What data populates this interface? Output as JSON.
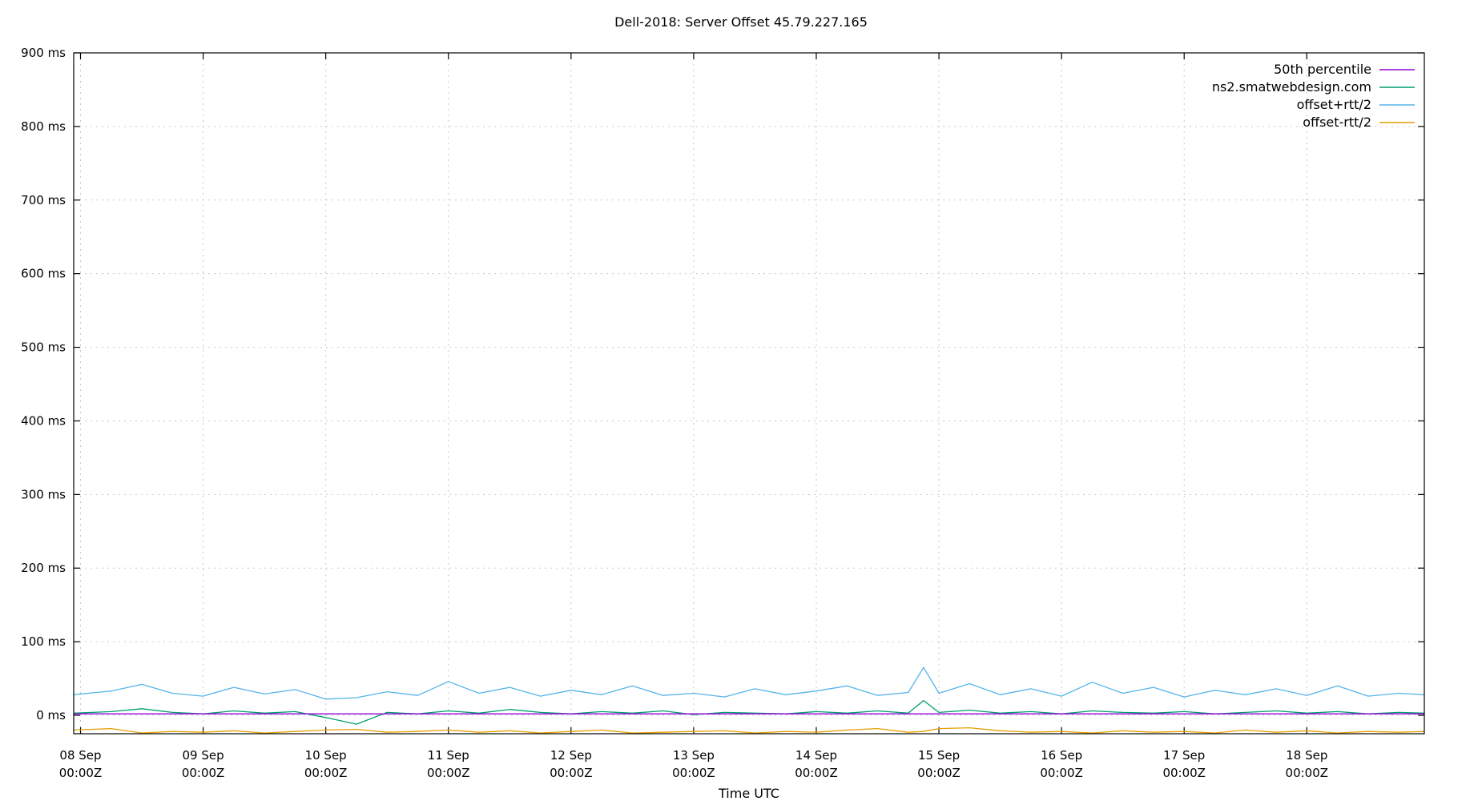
{
  "chart_data": {
    "type": "line",
    "title": "Dell-2018: Server Offset 45.79.227.165",
    "xlabel": "Time UTC",
    "ylabel": "",
    "x_range": [
      "2024-09-07T22:40:00Z",
      "2024-09-18T23:00:00Z"
    ],
    "ylim": [
      -25,
      900
    ],
    "y_ticks": [
      {
        "value": 0,
        "label": "0 ms"
      },
      {
        "value": 100,
        "label": "100 ms"
      },
      {
        "value": 200,
        "label": "200 ms"
      },
      {
        "value": 300,
        "label": "300 ms"
      },
      {
        "value": 400,
        "label": "400 ms"
      },
      {
        "value": 500,
        "label": "500 ms"
      },
      {
        "value": 600,
        "label": "600 ms"
      },
      {
        "value": 700,
        "label": "700 ms"
      },
      {
        "value": 800,
        "label": "800 ms"
      },
      {
        "value": 900,
        "label": "900 ms"
      }
    ],
    "x_ticks": [
      {
        "value": "2024-09-08T00:00:00Z",
        "line1": "08 Sep",
        "line2": "00:00Z"
      },
      {
        "value": "2024-09-09T00:00:00Z",
        "line1": "09 Sep",
        "line2": "00:00Z"
      },
      {
        "value": "2024-09-10T00:00:00Z",
        "line1": "10 Sep",
        "line2": "00:00Z"
      },
      {
        "value": "2024-09-11T00:00:00Z",
        "line1": "11 Sep",
        "line2": "00:00Z"
      },
      {
        "value": "2024-09-12T00:00:00Z",
        "line1": "12 Sep",
        "line2": "00:00Z"
      },
      {
        "value": "2024-09-13T00:00:00Z",
        "line1": "13 Sep",
        "line2": "00:00Z"
      },
      {
        "value": "2024-09-14T00:00:00Z",
        "line1": "14 Sep",
        "line2": "00:00Z"
      },
      {
        "value": "2024-09-15T00:00:00Z",
        "line1": "15 Sep",
        "line2": "00:00Z"
      },
      {
        "value": "2024-09-16T00:00:00Z",
        "line1": "16 Sep",
        "line2": "00:00Z"
      },
      {
        "value": "2024-09-17T00:00:00Z",
        "line1": "17 Sep",
        "line2": "00:00Z"
      },
      {
        "value": "2024-09-18T00:00:00Z",
        "line1": "18 Sep",
        "line2": "00:00Z"
      }
    ],
    "grid": true,
    "legend_position": "top-right",
    "series": [
      {
        "name": "50th percentile",
        "color": "#9400d3",
        "x": [
          "2024-09-07T22:40:00Z",
          "2024-09-18T23:00:00Z"
        ],
        "values": [
          2,
          2
        ]
      },
      {
        "name": "ns2.smatwebdesign.com",
        "color": "#009e73",
        "x": [
          "2024-09-07T22:40:00Z",
          "2024-09-08T06:00:00Z",
          "2024-09-08T12:00:00Z",
          "2024-09-08T18:00:00Z",
          "2024-09-09T00:00:00Z",
          "2024-09-09T06:00:00Z",
          "2024-09-09T12:00:00Z",
          "2024-09-09T18:00:00Z",
          "2024-09-10T00:00:00Z",
          "2024-09-10T06:00:00Z",
          "2024-09-10T12:00:00Z",
          "2024-09-10T18:00:00Z",
          "2024-09-11T00:00:00Z",
          "2024-09-11T06:00:00Z",
          "2024-09-11T12:00:00Z",
          "2024-09-11T18:00:00Z",
          "2024-09-12T00:00:00Z",
          "2024-09-12T06:00:00Z",
          "2024-09-12T12:00:00Z",
          "2024-09-12T18:00:00Z",
          "2024-09-13T00:00:00Z",
          "2024-09-13T06:00:00Z",
          "2024-09-13T12:00:00Z",
          "2024-09-13T18:00:00Z",
          "2024-09-14T00:00:00Z",
          "2024-09-14T06:00:00Z",
          "2024-09-14T12:00:00Z",
          "2024-09-14T18:00:00Z",
          "2024-09-14T21:00:00Z",
          "2024-09-15T00:00:00Z",
          "2024-09-15T06:00:00Z",
          "2024-09-15T12:00:00Z",
          "2024-09-15T18:00:00Z",
          "2024-09-16T00:00:00Z",
          "2024-09-16T06:00:00Z",
          "2024-09-16T12:00:00Z",
          "2024-09-16T18:00:00Z",
          "2024-09-17T00:00:00Z",
          "2024-09-17T06:00:00Z",
          "2024-09-17T12:00:00Z",
          "2024-09-17T18:00:00Z",
          "2024-09-18T00:00:00Z",
          "2024-09-18T06:00:00Z",
          "2024-09-18T12:00:00Z",
          "2024-09-18T18:00:00Z",
          "2024-09-18T23:00:00Z"
        ],
        "values": [
          3,
          5,
          9,
          4,
          2,
          6,
          3,
          5,
          -3,
          -12,
          4,
          2,
          6,
          3,
          8,
          4,
          2,
          5,
          3,
          6,
          1,
          4,
          3,
          2,
          5,
          3,
          6,
          3,
          20,
          4,
          7,
          3,
          5,
          2,
          6,
          4,
          3,
          5,
          2,
          4,
          6,
          3,
          5,
          2,
          4,
          3
        ]
      },
      {
        "name": "offset+rtt/2",
        "color": "#56b4e9",
        "x": [
          "2024-09-07T22:40:00Z",
          "2024-09-08T06:00:00Z",
          "2024-09-08T12:00:00Z",
          "2024-09-08T18:00:00Z",
          "2024-09-09T00:00:00Z",
          "2024-09-09T06:00:00Z",
          "2024-09-09T12:00:00Z",
          "2024-09-09T18:00:00Z",
          "2024-09-10T00:00:00Z",
          "2024-09-10T06:00:00Z",
          "2024-09-10T12:00:00Z",
          "2024-09-10T18:00:00Z",
          "2024-09-11T00:00:00Z",
          "2024-09-11T06:00:00Z",
          "2024-09-11T12:00:00Z",
          "2024-09-11T18:00:00Z",
          "2024-09-12T00:00:00Z",
          "2024-09-12T06:00:00Z",
          "2024-09-12T12:00:00Z",
          "2024-09-12T18:00:00Z",
          "2024-09-13T00:00:00Z",
          "2024-09-13T06:00:00Z",
          "2024-09-13T12:00:00Z",
          "2024-09-13T18:00:00Z",
          "2024-09-14T00:00:00Z",
          "2024-09-14T06:00:00Z",
          "2024-09-14T12:00:00Z",
          "2024-09-14T18:00:00Z",
          "2024-09-14T21:00:00Z",
          "2024-09-15T00:00:00Z",
          "2024-09-15T06:00:00Z",
          "2024-09-15T12:00:00Z",
          "2024-09-15T18:00:00Z",
          "2024-09-16T00:00:00Z",
          "2024-09-16T06:00:00Z",
          "2024-09-16T12:00:00Z",
          "2024-09-16T18:00:00Z",
          "2024-09-17T00:00:00Z",
          "2024-09-17T06:00:00Z",
          "2024-09-17T12:00:00Z",
          "2024-09-17T18:00:00Z",
          "2024-09-18T00:00:00Z",
          "2024-09-18T06:00:00Z",
          "2024-09-18T12:00:00Z",
          "2024-09-18T18:00:00Z",
          "2024-09-18T23:00:00Z"
        ],
        "values": [
          28,
          33,
          42,
          30,
          26,
          38,
          29,
          35,
          22,
          24,
          32,
          27,
          46,
          30,
          38,
          26,
          34,
          28,
          40,
          27,
          30,
          25,
          36,
          28,
          33,
          40,
          27,
          31,
          65,
          30,
          43,
          28,
          36,
          26,
          45,
          30,
          38,
          25,
          34,
          28,
          36,
          27,
          40,
          26,
          30,
          28
        ]
      },
      {
        "name": "offset-rtt/2",
        "color": "#e69f00",
        "x": [
          "2024-09-07T22:40:00Z",
          "2024-09-08T06:00:00Z",
          "2024-09-08T12:00:00Z",
          "2024-09-08T18:00:00Z",
          "2024-09-09T00:00:00Z",
          "2024-09-09T06:00:00Z",
          "2024-09-09T12:00:00Z",
          "2024-09-09T18:00:00Z",
          "2024-09-10T00:00:00Z",
          "2024-09-10T06:00:00Z",
          "2024-09-10T12:00:00Z",
          "2024-09-10T18:00:00Z",
          "2024-09-11T00:00:00Z",
          "2024-09-11T06:00:00Z",
          "2024-09-11T12:00:00Z",
          "2024-09-11T18:00:00Z",
          "2024-09-12T00:00:00Z",
          "2024-09-12T06:00:00Z",
          "2024-09-12T12:00:00Z",
          "2024-09-12T18:00:00Z",
          "2024-09-13T00:00:00Z",
          "2024-09-13T06:00:00Z",
          "2024-09-13T12:00:00Z",
          "2024-09-13T18:00:00Z",
          "2024-09-14T00:00:00Z",
          "2024-09-14T06:00:00Z",
          "2024-09-14T12:00:00Z",
          "2024-09-14T18:00:00Z",
          "2024-09-14T21:00:00Z",
          "2024-09-15T00:00:00Z",
          "2024-09-15T06:00:00Z",
          "2024-09-15T12:00:00Z",
          "2024-09-15T18:00:00Z",
          "2024-09-16T00:00:00Z",
          "2024-09-16T06:00:00Z",
          "2024-09-16T12:00:00Z",
          "2024-09-16T18:00:00Z",
          "2024-09-17T00:00:00Z",
          "2024-09-17T06:00:00Z",
          "2024-09-17T12:00:00Z",
          "2024-09-17T18:00:00Z",
          "2024-09-18T00:00:00Z",
          "2024-09-18T06:00:00Z",
          "2024-09-18T12:00:00Z",
          "2024-09-18T18:00:00Z",
          "2024-09-18T23:00:00Z"
        ],
        "values": [
          -20,
          -18,
          -24,
          -22,
          -23,
          -21,
          -24,
          -22,
          -20,
          -19,
          -23,
          -22,
          -20,
          -23,
          -21,
          -24,
          -22,
          -20,
          -24,
          -23,
          -22,
          -21,
          -24,
          -22,
          -23,
          -20,
          -18,
          -23,
          -22,
          -18,
          -17,
          -21,
          -23,
          -22,
          -24,
          -21,
          -23,
          -22,
          -24,
          -20,
          -23,
          -21,
          -24,
          -22,
          -23,
          -22
        ]
      }
    ]
  }
}
